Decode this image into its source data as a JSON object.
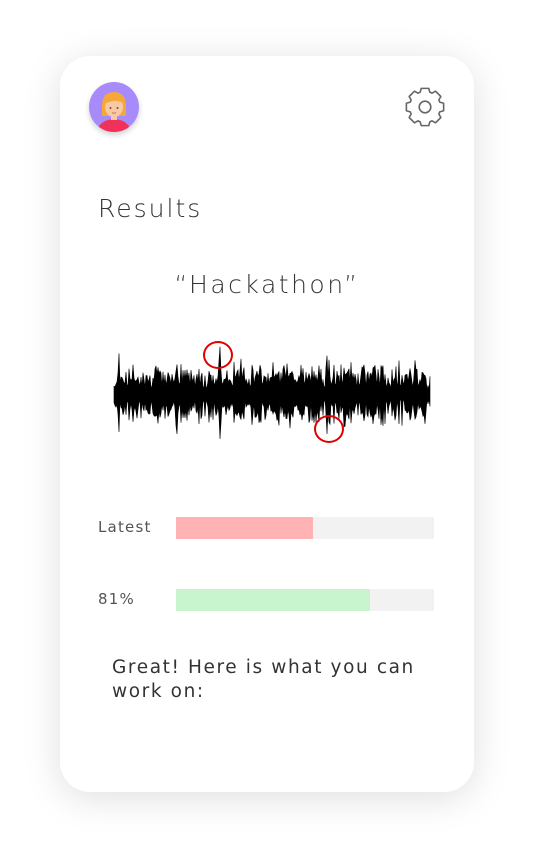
{
  "colors": {
    "background": "#ffffff",
    "text": "#333333",
    "avatar_bg": "#a78bfa",
    "latest_bar": "#ffb3b5",
    "score_bar": "#c8f5cd",
    "bar_track": "#f2f2f2",
    "marker": "#e00000"
  },
  "header": {
    "avatar_icon": "user-avatar-girl",
    "settings_icon": "gear-icon"
  },
  "page": {
    "title": "Results"
  },
  "recording": {
    "word": "“Hackathon”",
    "waveform": "audio-waveform",
    "marker_count": 2
  },
  "metrics": [
    {
      "label": "Latest",
      "value": 0.53,
      "color": "#ffb3b5"
    },
    {
      "label": "81%",
      "value": 0.75,
      "color": "#c8f5cd"
    }
  ],
  "feedback": {
    "text": "Great! Here is what you can work on:"
  }
}
